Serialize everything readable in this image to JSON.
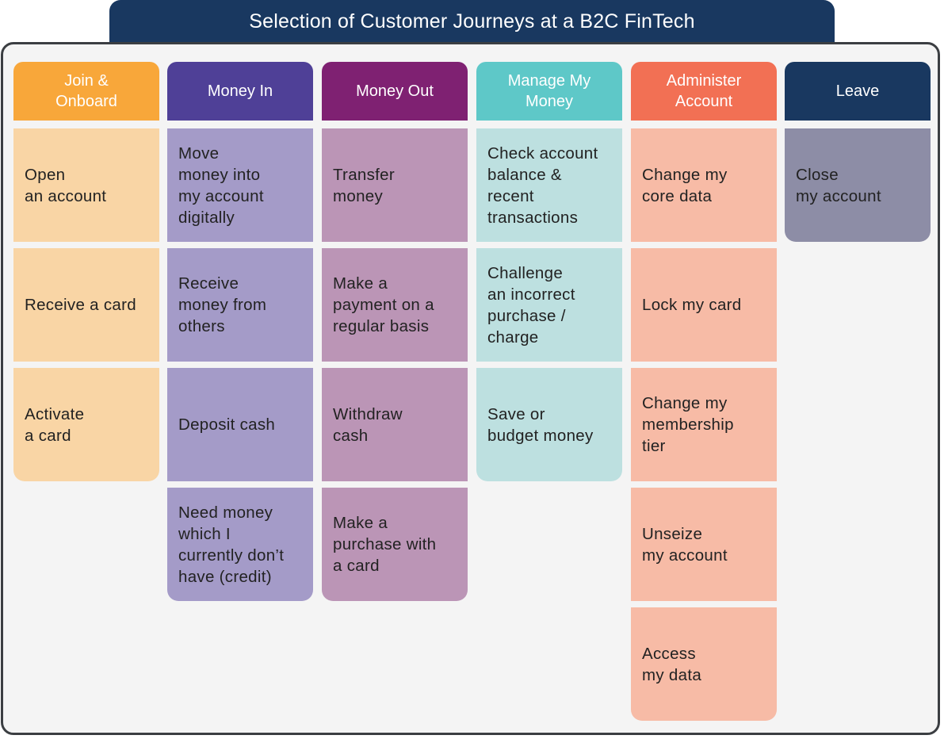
{
  "title": "Selection of Customer Journeys at a B2C FinTech",
  "columns": [
    {
      "header": "Join &\nOnboard",
      "header_color": "#F8A73A",
      "card_color": "#F9D5A5",
      "cards": [
        "Open\nan account",
        "Receive a card",
        "Activate\na card"
      ]
    },
    {
      "header": "Money In",
      "header_color": "#4F4097",
      "card_color": "#A49BC8",
      "cards": [
        "Move\nmoney into\nmy account\ndigitally",
        "Receive\nmoney from\nothers",
        "Deposit cash",
        "Need money\nwhich I\ncurrently don’t\nhave (credit)"
      ]
    },
    {
      "header": "Money Out",
      "header_color": "#7F2172",
      "card_color": "#BB95B6",
      "cards": [
        "Transfer\nmoney",
        "Make a\npayment on a\nregular basis",
        "Withdraw\ncash",
        "Make a\npurchase with\na card"
      ]
    },
    {
      "header": "Manage My\nMoney",
      "header_color": "#5EC8C8",
      "card_color": "#BDE0E0",
      "cards": [
        "Check account\nbalance &\nrecent\ntransactions",
        "Challenge\nan incorrect\npurchase /\ncharge",
        "Save or\nbudget money"
      ]
    },
    {
      "header": "Administer\nAccount",
      "header_color": "#F27054",
      "card_color": "#F7BBA6",
      "cards": [
        "Change my\ncore data",
        "Lock my card",
        "Change my\nmembership\ntier",
        "Unseize\nmy account",
        "Access\nmy data"
      ]
    },
    {
      "header": "Leave",
      "header_color": "#193860",
      "card_color": "#8D8DA6",
      "cards": [
        "Close\nmy account"
      ]
    }
  ]
}
